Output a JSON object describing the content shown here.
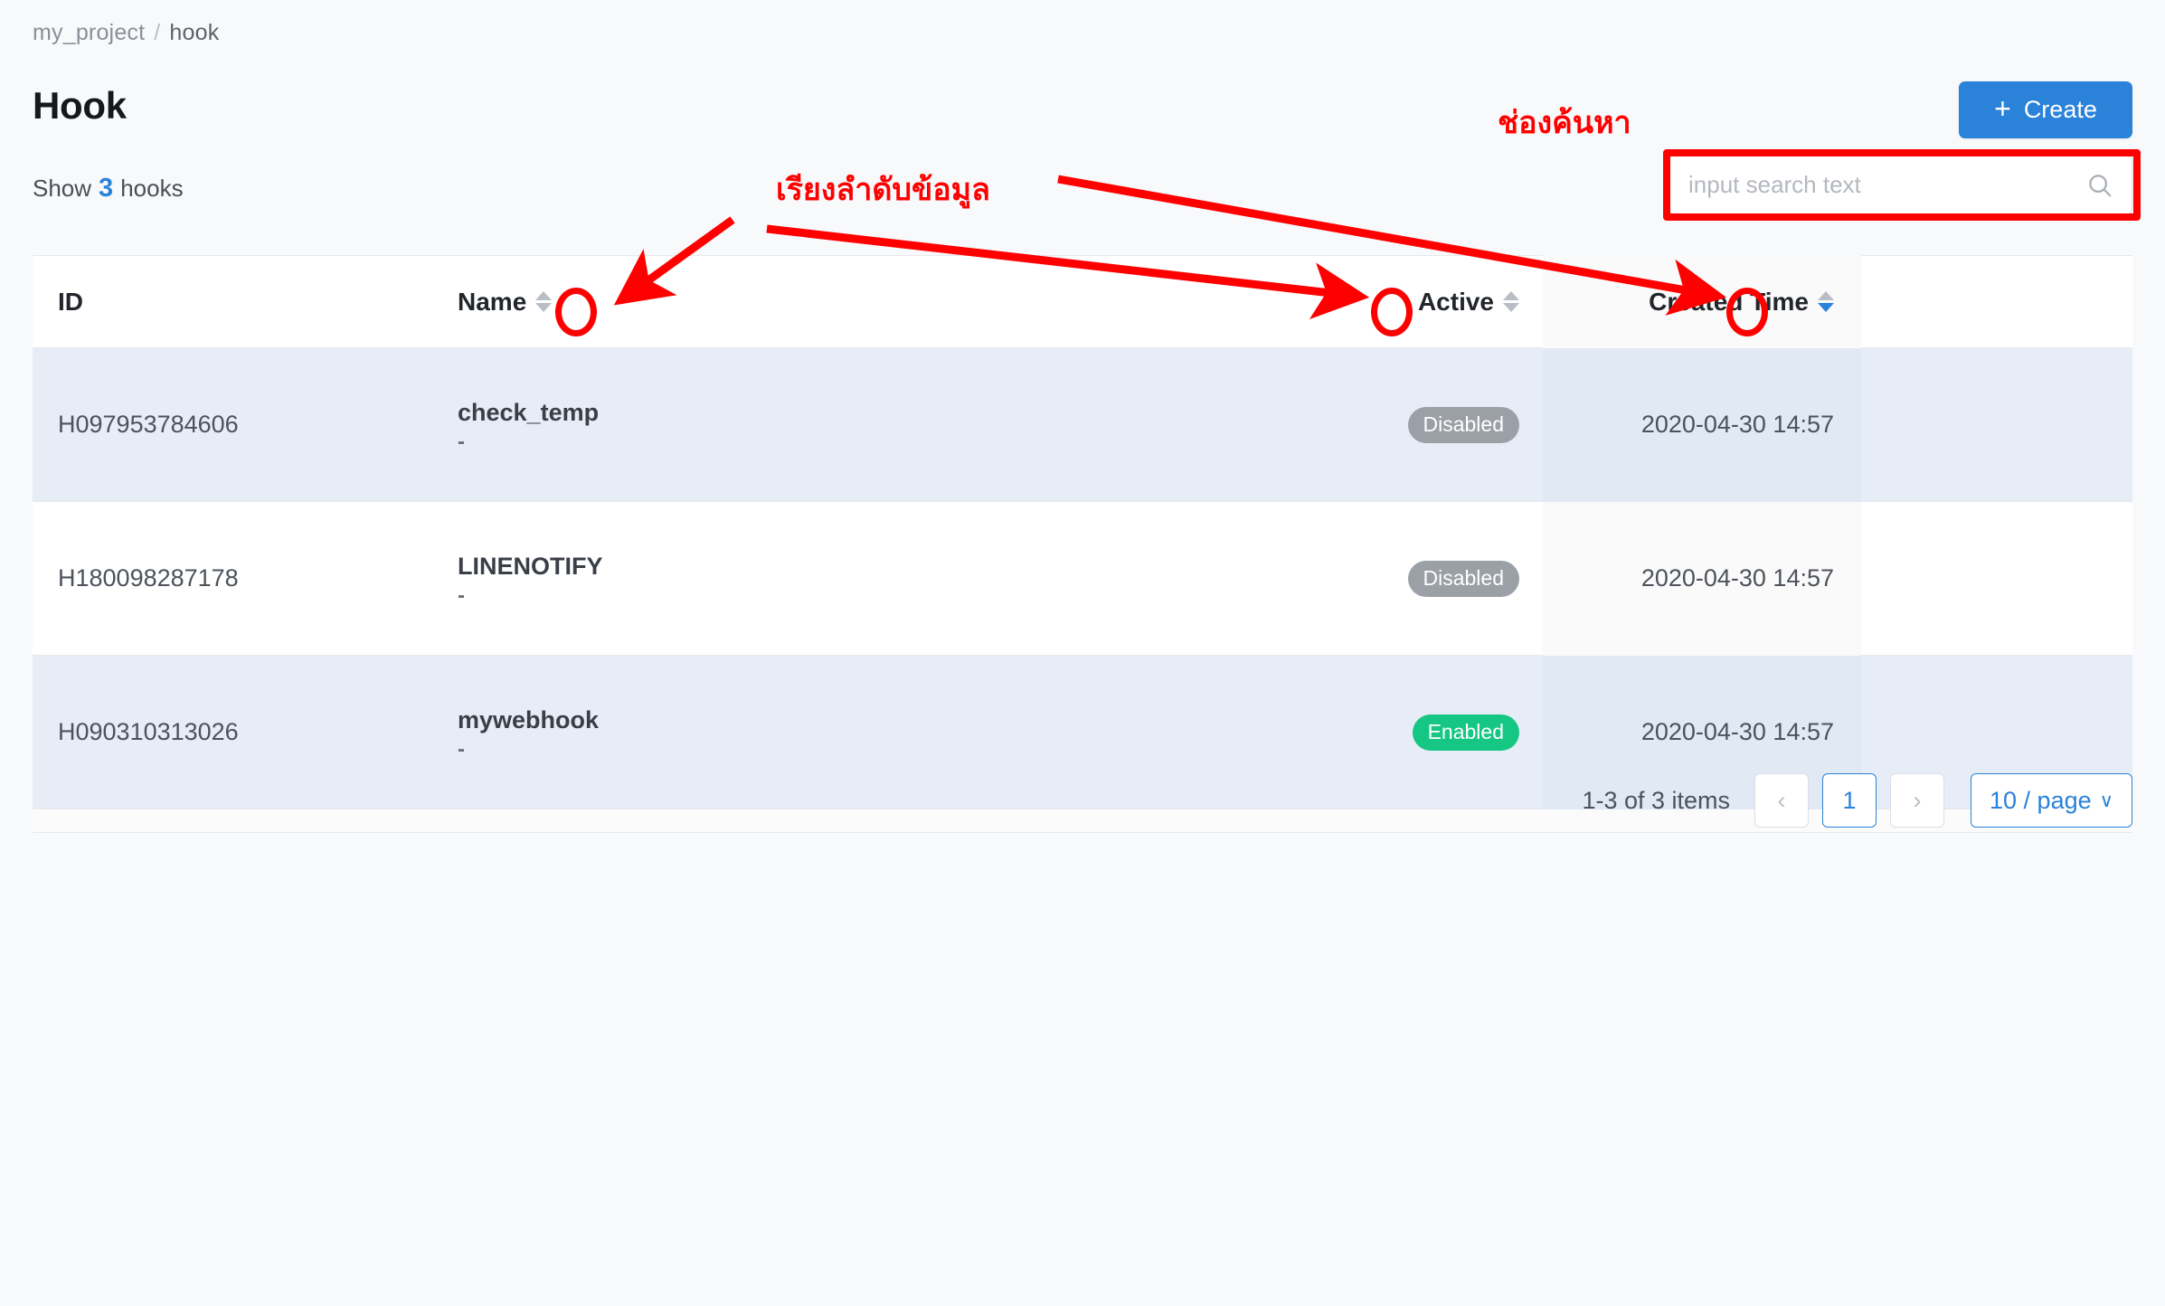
{
  "breadcrumb": {
    "project": "my_project",
    "separator": "/",
    "current": "hook"
  },
  "header": {
    "title": "Hook",
    "show_prefix": "Show",
    "show_count": "3",
    "show_suffix": "hooks"
  },
  "toolbar": {
    "create_label": "Create",
    "create_plus": "+",
    "create_color": "#2a82d9"
  },
  "search": {
    "placeholder": "input search text",
    "value": "",
    "icon": "search-icon"
  },
  "table": {
    "columns": [
      {
        "key": "id",
        "label": "ID",
        "sortable": false,
        "sort_state": "none"
      },
      {
        "key": "name",
        "label": "Name",
        "sortable": true,
        "sort_state": "none"
      },
      {
        "key": "active",
        "label": "Active",
        "sortable": true,
        "sort_state": "none"
      },
      {
        "key": "time",
        "label": "Created Time",
        "sortable": true,
        "sort_state": "descend"
      }
    ],
    "rows": [
      {
        "id": "H097953784606",
        "name": "check_temp",
        "name_sub": "-",
        "active_label": "Disabled",
        "active_state": "disabled",
        "created_time": "2020-04-30 14:57"
      },
      {
        "id": "H180098287178",
        "name": "LINENOTIFY",
        "name_sub": "-",
        "active_label": "Disabled",
        "active_state": "disabled",
        "created_time": "2020-04-30 14:57"
      },
      {
        "id": "H090310313026",
        "name": "mywebhook",
        "name_sub": "-",
        "active_label": "Enabled",
        "active_state": "enabled",
        "created_time": "2020-04-30 14:57"
      }
    ],
    "badge_colors": {
      "disabled": "#9ba0a6",
      "enabled": "#16c784"
    }
  },
  "pagination": {
    "total_text": "1-3 of 3 items",
    "prev_label": "‹",
    "next_label": "›",
    "current_page": "1",
    "page_size_label": "10 / page",
    "page_size_chevron": "∨"
  },
  "annotations": {
    "color": "#ff0000",
    "sort_label": "เรียงลำดับข้อมูล",
    "search_label": "ช่องค้นหา"
  }
}
